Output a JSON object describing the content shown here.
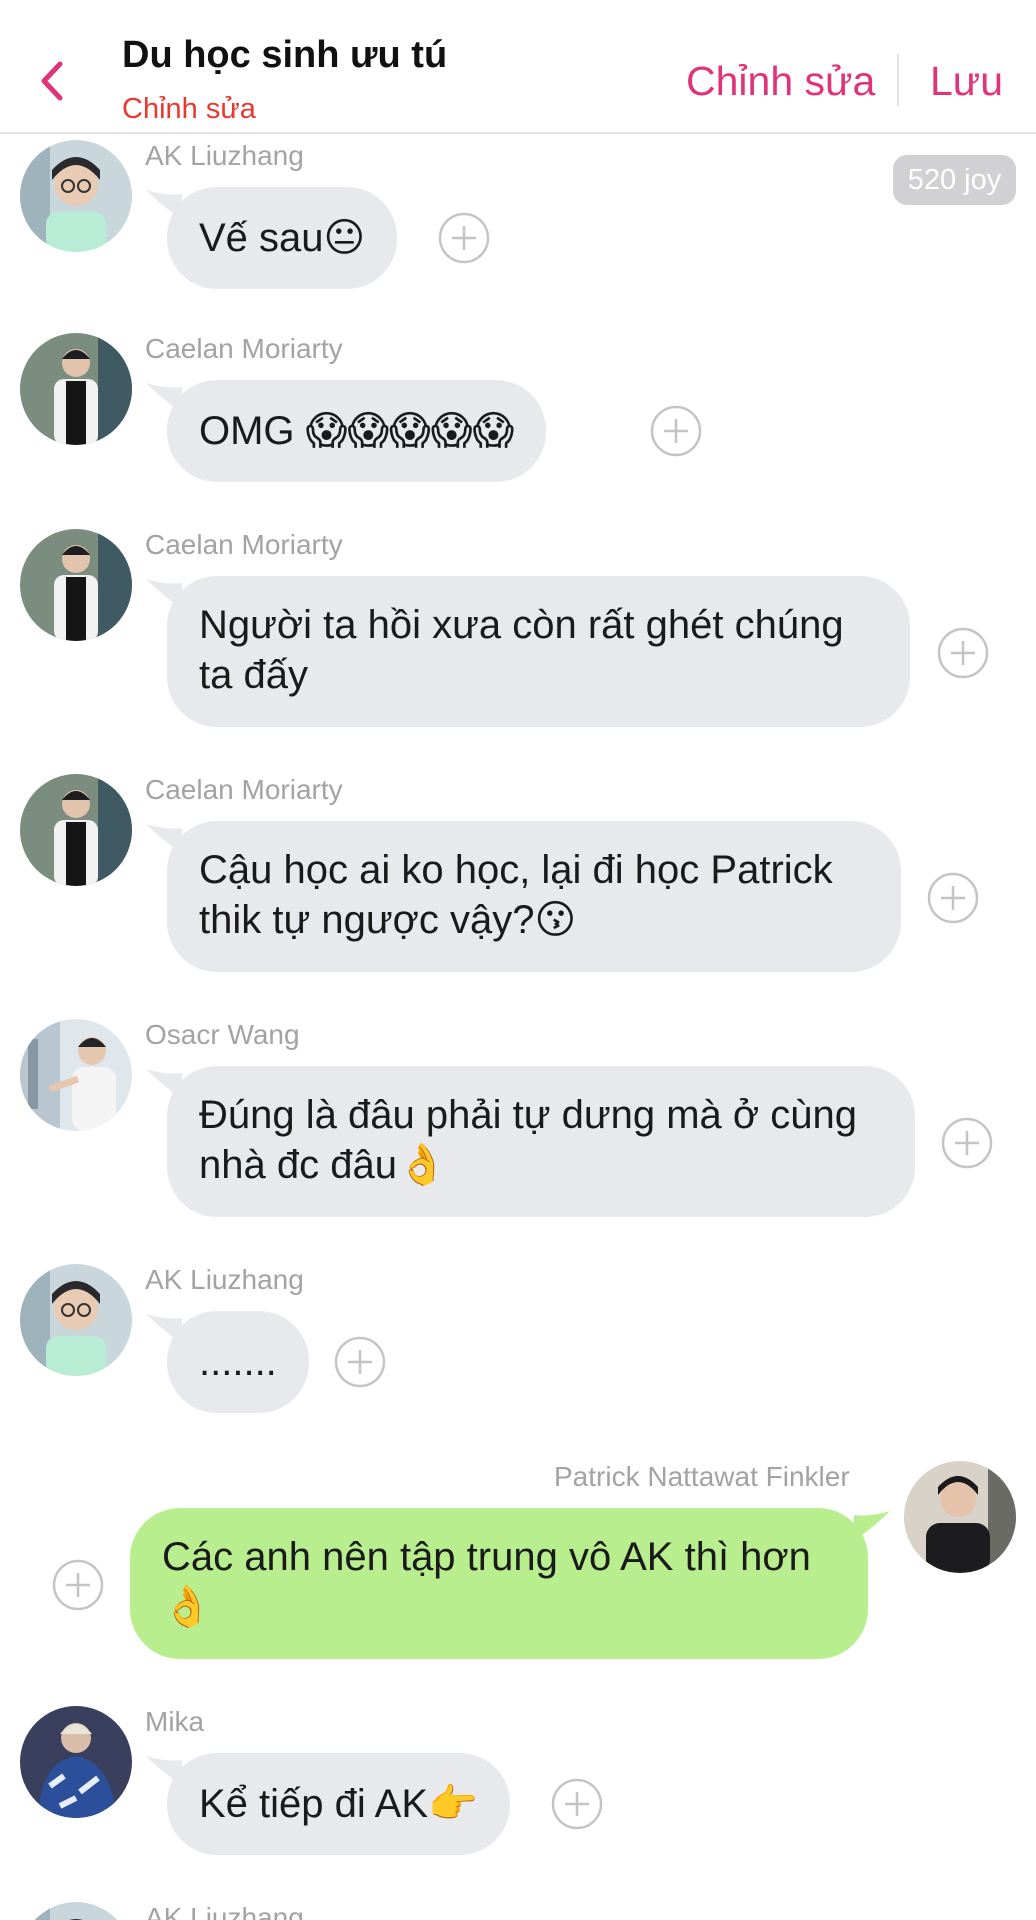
{
  "header": {
    "title": "Du học sinh ưu tú",
    "subtitle": "Chỉnh sửa",
    "edit_label": "Chỉnh sửa",
    "save_label": "Lưu",
    "accent": "#e0347a"
  },
  "joy_badge": "520 joy",
  "messages": [
    {
      "sender": "AK Liuzhang",
      "text": "Vế sau😐",
      "side": "in"
    },
    {
      "sender": "Caelan Moriarty",
      "text": "OMG 😱😱😱😱😱",
      "side": "in"
    },
    {
      "sender": "Caelan Moriarty",
      "text": "Người ta hồi xưa còn rất ghét chúng ta đấy",
      "side": "in"
    },
    {
      "sender": "Caelan Moriarty",
      "text": "Cậu học ai ko học, lại đi học Patrick thik tự ngược vậy?😗",
      "side": "in"
    },
    {
      "sender": "Osacr Wang",
      "text": "Đúng là đâu phải tự dưng mà ở cùng nhà đc đâu👌",
      "side": "in"
    },
    {
      "sender": "AK Liuzhang",
      "text": ".......",
      "side": "in"
    },
    {
      "sender": "Patrick Nattawat Finkler",
      "text": "Các anh nên tập trung vô AK thì hơn👌",
      "side": "out"
    },
    {
      "sender": "Mika",
      "text": "Kể tiếp đi AK👉",
      "side": "in"
    },
    {
      "sender": "AK Liuzhang",
      "text": "",
      "side": "in"
    }
  ],
  "icons": {
    "back": "chevron-left-icon",
    "add_reaction": "plus-circle-icon"
  },
  "colors": {
    "incoming_bubble": "#e7e9ed",
    "outgoing_bubble": "#b9ee8f",
    "sender_name": "#a3a3a7",
    "subtitle": "#e8392f"
  }
}
